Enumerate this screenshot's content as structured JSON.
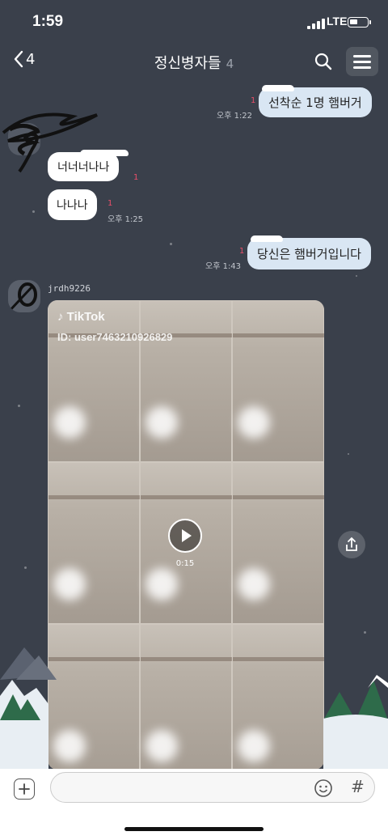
{
  "status": {
    "time": "1:59",
    "network": "LTE"
  },
  "nav": {
    "back_count": "4",
    "title": "정신병자들",
    "member_count": "4"
  },
  "messages": {
    "m1": {
      "text": "선착순 1명 햄버거",
      "unread": "1",
      "time": "오후 1:22"
    },
    "m2": {
      "text": "너너너나나",
      "unread": "1"
    },
    "m3": {
      "text": "나나나",
      "unread": "1",
      "time": "오후 1:25"
    },
    "m4": {
      "text": "당신은 햄버거입니다",
      "unread": "1",
      "time": "오후 1:43"
    },
    "m5": {
      "sender": "jrdh9226",
      "video_brand": "TikTok",
      "video_id": "ID: user7463210926829",
      "duration": "0:15"
    }
  },
  "colors": {
    "bg": "#3a404b",
    "my_bubble": "#d9e6f3",
    "other_bubble": "#ffffff",
    "unread": "#e94e6a"
  },
  "icons": [
    "back-chevron-icon",
    "search-icon",
    "menu-icon",
    "play-icon",
    "share-icon",
    "plus-icon",
    "emoji-icon",
    "hash-icon",
    "signal-icon",
    "battery-icon"
  ]
}
